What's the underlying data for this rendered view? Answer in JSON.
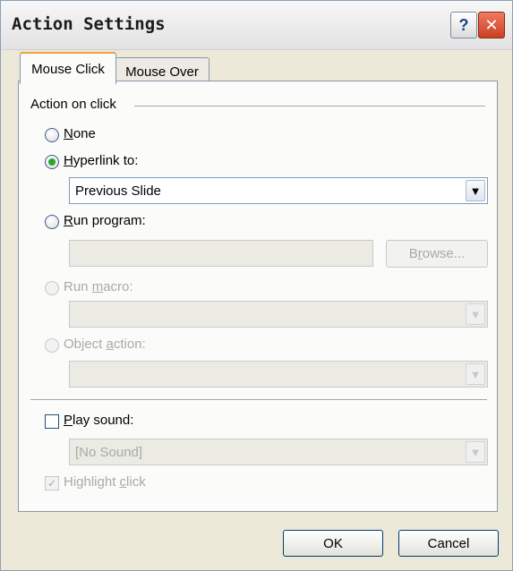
{
  "window": {
    "title": "Action Settings",
    "help_glyph": "?",
    "close_glyph": "✕"
  },
  "tabs": [
    {
      "label": "Mouse Click",
      "selected": true
    },
    {
      "label": "Mouse Over",
      "selected": false
    }
  ],
  "group": {
    "label": "Action on click"
  },
  "options": {
    "none": {
      "label_ul": "N",
      "label_rest": "one",
      "selected": false
    },
    "hyperlink": {
      "label_ul": "H",
      "label_rest": "yperlink to:",
      "selected": true,
      "value": "Previous Slide"
    },
    "run_program": {
      "label_ul": "R",
      "label_rest": "un program:",
      "selected": false,
      "value": "",
      "browse_label_pre": "B",
      "browse_label_ul": "r",
      "browse_label_post": "owse..."
    },
    "run_macro": {
      "label_pre": "Run ",
      "label_ul": "m",
      "label_rest": "acro:",
      "disabled": true,
      "value": ""
    },
    "object_action": {
      "label_pre": "Object ",
      "label_ul": "a",
      "label_rest": "ction:",
      "disabled": true,
      "value": ""
    }
  },
  "sound": {
    "label_ul": "P",
    "label_rest": "lay sound:",
    "checked": false,
    "value": "[No Sound]"
  },
  "highlight": {
    "label_pre": "Highlight ",
    "label_ul": "c",
    "label_rest": "lick",
    "checked": true,
    "disabled": true
  },
  "buttons": {
    "ok": "OK",
    "cancel": "Cancel"
  },
  "icons": {
    "dropdown": "chevron-down-icon",
    "check": "checkmark-icon"
  },
  "colors": {
    "radio_selected": "#27a627",
    "active_tab_accent": "#f0a040"
  }
}
